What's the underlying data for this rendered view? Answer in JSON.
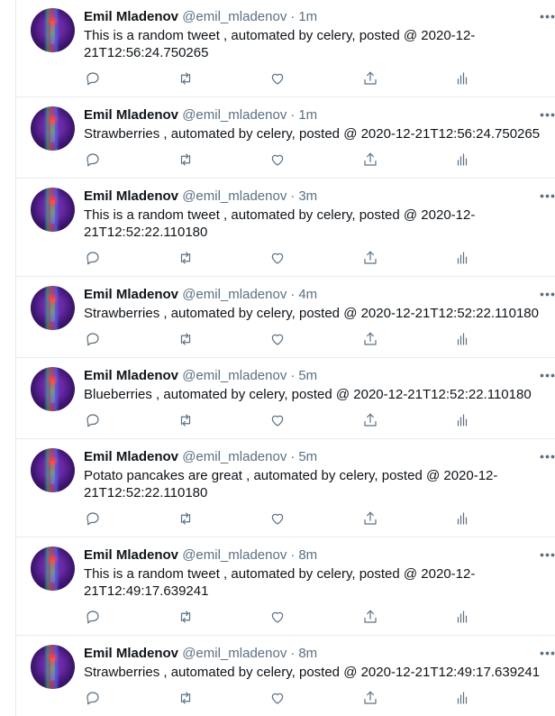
{
  "accent_color": "#1da1f2",
  "muted_color": "#5b7083",
  "icons": {
    "reply": "reply-icon",
    "retweet": "retweet-icon",
    "like": "like-icon",
    "share": "share-icon",
    "analytics": "analytics-icon",
    "more": "more-icon"
  },
  "tweets": [
    {
      "name": "Emil Mladenov",
      "handle": "@emil_mladenov",
      "dot": "·",
      "time": "1m",
      "text": "This is a random tweet , automated by celery, posted @ 2020-12-21T12:56:24.750265"
    },
    {
      "name": "Emil Mladenov",
      "handle": "@emil_mladenov",
      "dot": "·",
      "time": "1m",
      "text": "Strawberries , automated by celery, posted @ 2020-12-21T12:56:24.750265"
    },
    {
      "name": "Emil Mladenov",
      "handle": "@emil_mladenov",
      "dot": "·",
      "time": "3m",
      "text": "This is a random tweet , automated by celery, posted @ 2020-12-21T12:52:22.110180"
    },
    {
      "name": "Emil Mladenov",
      "handle": "@emil_mladenov",
      "dot": "·",
      "time": "4m",
      "text": "Strawberries , automated by celery, posted @ 2020-12-21T12:52:22.110180"
    },
    {
      "name": "Emil Mladenov",
      "handle": "@emil_mladenov",
      "dot": "·",
      "time": "5m",
      "text": "Blueberries , automated by celery, posted @ 2020-12-21T12:52:22.110180"
    },
    {
      "name": "Emil Mladenov",
      "handle": "@emil_mladenov",
      "dot": "·",
      "time": "5m",
      "text": "Potato pancakes are great , automated by celery, posted @ 2020-12-21T12:52:22.110180"
    },
    {
      "name": "Emil Mladenov",
      "handle": "@emil_mladenov",
      "dot": "·",
      "time": "8m",
      "text": "This is a random tweet , automated by celery, posted @ 2020-12-21T12:49:17.639241"
    },
    {
      "name": "Emil Mladenov",
      "handle": "@emil_mladenov",
      "dot": "·",
      "time": "8m",
      "text": "Strawberries , automated by celery, posted @ 2020-12-21T12:49:17.639241"
    }
  ]
}
